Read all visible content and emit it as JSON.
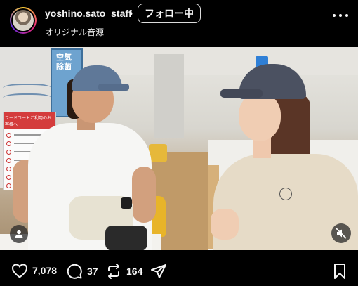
{
  "header": {
    "username": "yoshino.sato_staff",
    "separator": "•",
    "follow_label": "フォロー中",
    "audio_label": "オリジナル音源"
  },
  "video": {
    "banner_text": "空気\n除菌",
    "sign_title": "フードコートご利用のお客様へ"
  },
  "actions": {
    "likes": "7,078",
    "comments": "37",
    "reposts": "164"
  },
  "icons": {
    "avatar": "avatar",
    "more": "more-dots-icon",
    "like": "heart-icon",
    "comment": "comment-bubble-icon",
    "repost": "repost-icon",
    "share": "send-icon",
    "save": "bookmark-icon",
    "user_tag": "user-tag-icon",
    "mute": "speaker-muted-icon"
  }
}
